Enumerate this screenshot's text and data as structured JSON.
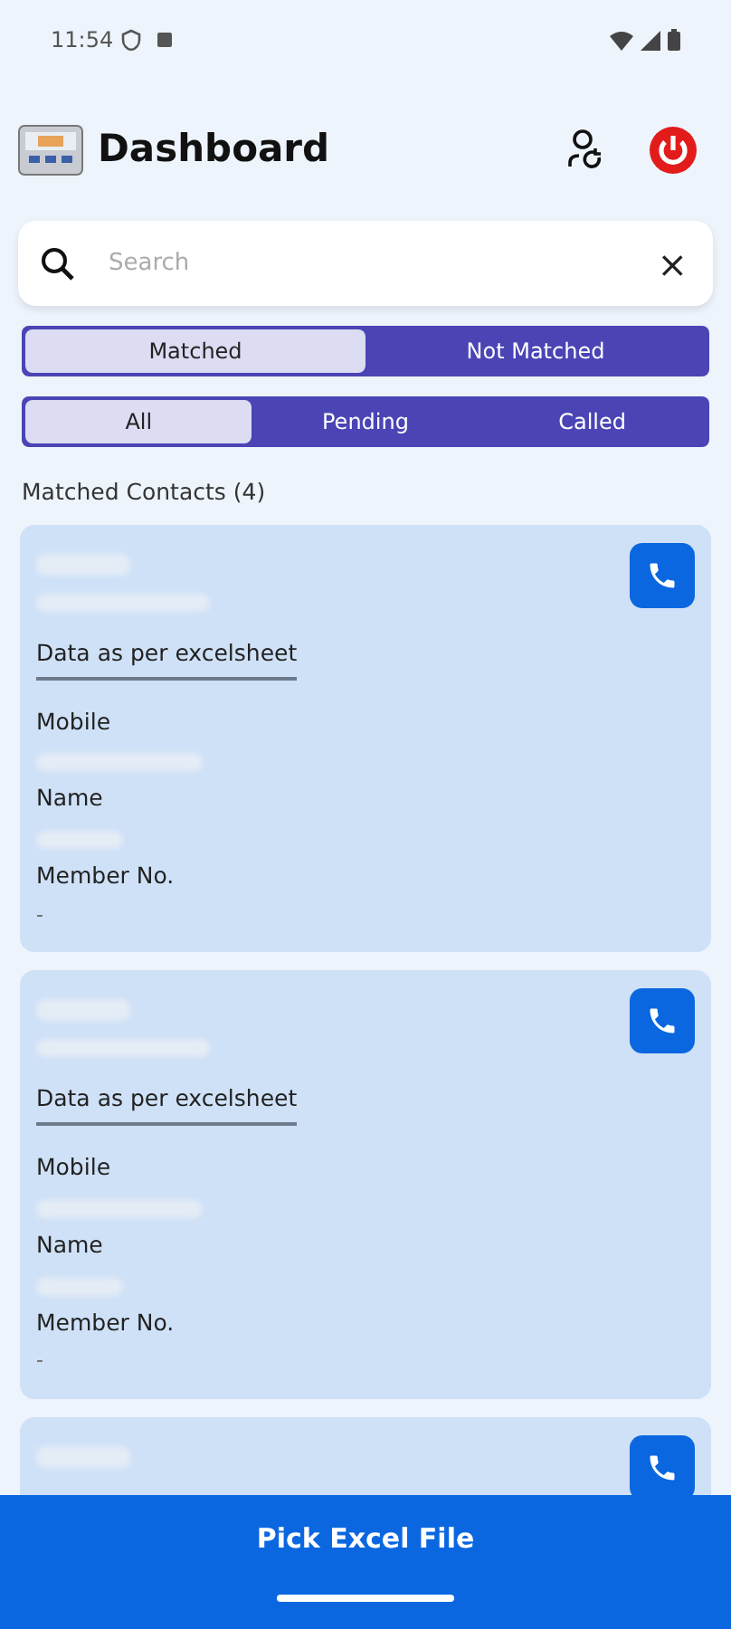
{
  "status_bar": {
    "time": "11:54"
  },
  "header": {
    "title": "Dashboard"
  },
  "search": {
    "placeholder": "Search",
    "clear": "×"
  },
  "match_tabs": [
    {
      "label": "Matched",
      "selected": true
    },
    {
      "label": "Not Matched",
      "selected": false
    }
  ],
  "filter_tabs": [
    {
      "label": "All",
      "selected": true
    },
    {
      "label": "Pending",
      "selected": false
    },
    {
      "label": "Called",
      "selected": false
    }
  ],
  "list_title": "Matched Contacts (4)",
  "cards": [
    {
      "redacted_header": true,
      "section_title": "Data as per excelsheet",
      "fields": [
        {
          "label": "Mobile",
          "redacted": true
        },
        {
          "label": "Name",
          "redacted": true
        },
        {
          "label": "Member No.",
          "value": "-"
        }
      ]
    },
    {
      "redacted_header": true,
      "section_title": "Data as per excelsheet",
      "fields": [
        {
          "label": "Mobile",
          "redacted": true
        },
        {
          "label": "Name",
          "redacted": true
        },
        {
          "label": "Member No.",
          "value": "-"
        }
      ]
    },
    {
      "redacted_header": true
    }
  ],
  "bottom_button": "Pick Excel File"
}
